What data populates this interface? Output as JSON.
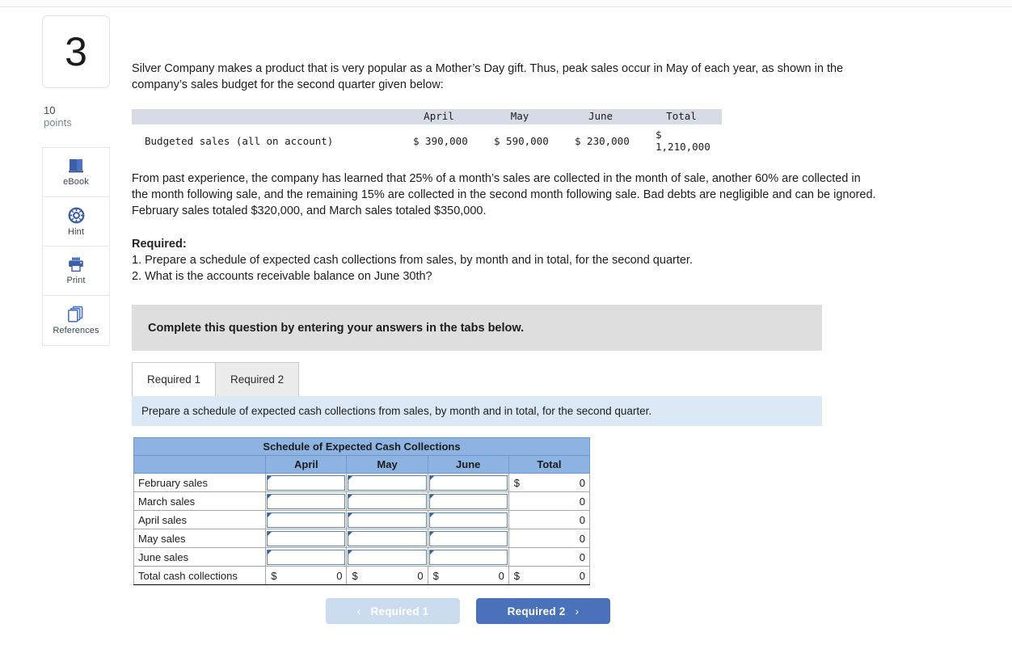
{
  "question": {
    "number": "3",
    "points_value": "10",
    "points_label": "points"
  },
  "tools": [
    {
      "label": "eBook",
      "icon": "book-icon"
    },
    {
      "label": "Hint",
      "icon": "life-ring-icon"
    },
    {
      "label": "Print",
      "icon": "printer-icon"
    },
    {
      "label": "References",
      "icon": "documents-stack-icon"
    }
  ],
  "problem": {
    "intro": "Silver Company makes a product that is very popular as a Mother’s Day gift. Thus, peak sales occur in May of each year, as shown in the company’s sales budget for the second quarter given below:",
    "budget_table": {
      "columns": [
        "April",
        "May",
        "June",
        "Total"
      ],
      "row_label": "Budgeted sales (all on account)",
      "values": [
        "$ 390,000",
        "$ 590,000",
        "$ 230,000",
        "$ 1,210,000"
      ]
    },
    "detail": "From past experience, the company has learned that 25% of a month’s sales are collected in the month of sale, another 60% are collected in the month following sale, and the remaining 15% are collected in the second month following sale. Bad debts are negligible and can be ignored. February sales totaled $320,000, and March sales totaled $350,000.",
    "required_heading": "Required:",
    "required_items": [
      "1. Prepare a schedule of expected cash collections from sales, by month and in total, for the second quarter.",
      "2. What is the accounts receivable balance on June 30th?"
    ]
  },
  "banner": {
    "text": "Complete this question by entering your answers in the tabs below."
  },
  "tabs": [
    {
      "label": "Required 1",
      "active": true
    },
    {
      "label": "Required 2",
      "active": false
    }
  ],
  "sub_instruction": "Prepare a schedule of expected cash collections from sales, by month and in total, for the second quarter.",
  "answer_grid": {
    "title": "Schedule of Expected Cash Collections",
    "columns": [
      "April",
      "May",
      "June",
      "Total"
    ],
    "rows": [
      {
        "label": "February sales",
        "inputs": [
          "",
          "",
          ""
        ],
        "total_dollar": "$",
        "total_value": "0"
      },
      {
        "label": "March sales",
        "inputs": [
          "",
          "",
          ""
        ],
        "total_dollar": "",
        "total_value": "0"
      },
      {
        "label": "April sales",
        "inputs": [
          "",
          "",
          ""
        ],
        "total_dollar": "",
        "total_value": "0"
      },
      {
        "label": "May sales",
        "inputs": [
          "",
          "",
          ""
        ],
        "total_dollar": "",
        "total_value": "0"
      },
      {
        "label": "June sales",
        "inputs": [
          "",
          "",
          ""
        ],
        "total_dollar": "",
        "total_value": "0"
      }
    ],
    "total_row": {
      "label": "Total cash collections",
      "cells": [
        {
          "dollar": "$",
          "value": "0"
        },
        {
          "dollar": "$",
          "value": "0"
        },
        {
          "dollar": "$",
          "value": "0"
        },
        {
          "dollar": "$",
          "value": "0"
        }
      ]
    }
  },
  "navigation": {
    "prev_label": "Required 1",
    "prev_chevron": "‹",
    "next_label": "Required 2",
    "next_chevron": "›"
  },
  "colors": {
    "accent_blue": "#4a72ba",
    "header_blue": "#8db3e2",
    "sub_instruction_blue": "#dbe9f7",
    "banner_gray": "#dedede",
    "input_border": "#5c82bd"
  }
}
